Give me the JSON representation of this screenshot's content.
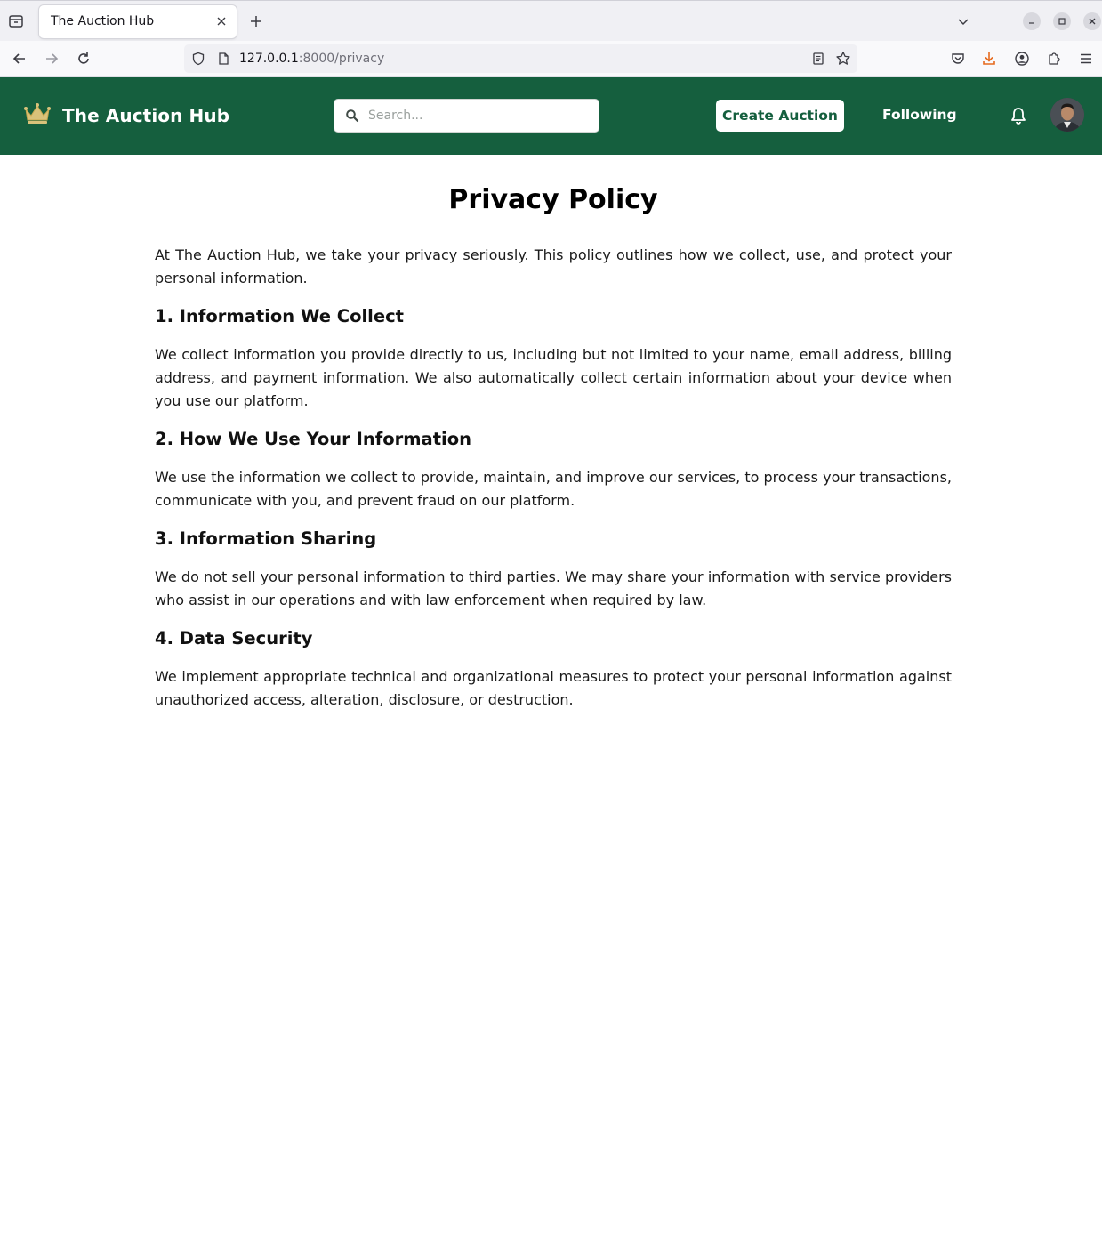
{
  "browser": {
    "tab_title": "The Auction Hub",
    "url_host": "127.0.0.1",
    "url_rest": ":8000/privacy"
  },
  "header": {
    "brand_name": "The Auction Hub",
    "brand_color": "#155f3e",
    "search_placeholder": "Search...",
    "create_button": "Create Auction",
    "following_link": "Following"
  },
  "page": {
    "title": "Privacy Policy",
    "intro": "At The Auction Hub, we take your privacy seriously. This policy outlines how we collect, use, and protect your personal information.",
    "sections": [
      {
        "heading": "1. Information We Collect",
        "body": "We collect information you provide directly to us, including but not limited to your name, email address, billing address, and payment information. We also automatically collect certain information about your device when you use our platform."
      },
      {
        "heading": "2. How We Use Your Information",
        "body": "We use the information we collect to provide, maintain, and improve our services, to process your transactions, communicate with you, and prevent fraud on our platform."
      },
      {
        "heading": "3. Information Sharing",
        "body": "We do not sell your personal information to third parties. We may share your information with service providers who assist in our operations and with law enforcement when required by law."
      },
      {
        "heading": "4. Data Security",
        "body": "We implement appropriate technical and organizational measures to protect your personal information against unauthorized access, alteration, disclosure, or destruction."
      }
    ]
  }
}
